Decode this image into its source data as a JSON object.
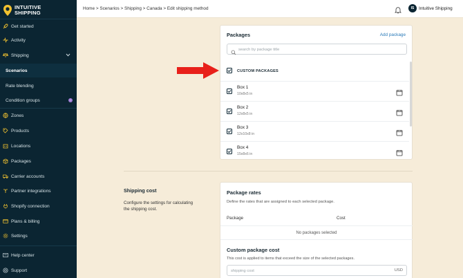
{
  "app": {
    "logo_line1": "INTUITIVE",
    "logo_line2": "SHIPPING"
  },
  "sidebar": {
    "items": [
      {
        "label": "Get started",
        "icon": "rocket-icon"
      },
      {
        "label": "Activity",
        "icon": "activity-icon"
      },
      {
        "label": "Shipping",
        "icon": "scale-icon"
      },
      {
        "label": "Scenarios"
      },
      {
        "label": "Rate blending"
      },
      {
        "label": "Condition groups",
        "badge": "i"
      },
      {
        "label": "Zones",
        "icon": "globe-icon"
      },
      {
        "label": "Products",
        "icon": "tag-icon"
      },
      {
        "label": "Locations",
        "icon": "building-icon"
      },
      {
        "label": "Packages",
        "icon": "boxes-icon"
      },
      {
        "label": "Carrier accounts",
        "icon": "truck-icon"
      },
      {
        "label": "Partner integrations",
        "icon": "link-icon"
      },
      {
        "label": "Shopify connection",
        "icon": "plug-icon"
      },
      {
        "label": "Plans & billing",
        "icon": "card-icon"
      },
      {
        "label": "Settings",
        "icon": "gear-icon"
      },
      {
        "label": "Help center",
        "icon": "help-icon"
      },
      {
        "label": "Support",
        "icon": "support-icon"
      }
    ]
  },
  "header": {
    "breadcrumb": "Home > Scenarios > Shipping > Canada > Edit shipping method",
    "user_initials": "IS",
    "user_name": "Intuitive Shipping"
  },
  "packages": {
    "title": "Packages",
    "add_label": "Add package",
    "search_placeholder": "search by package title",
    "group_label": "CUSTOM PACKAGES",
    "items": [
      {
        "name": "Box 1",
        "dims": "10x8x5 in"
      },
      {
        "name": "Box 2",
        "dims": "12x8x5 in"
      },
      {
        "name": "Box 3",
        "dims": "12x10x8 in"
      },
      {
        "name": "Box 4",
        "dims": "15x8x6 in"
      }
    ]
  },
  "shipping_cost": {
    "title": "Shipping cost",
    "description": "Configure the settings for calculating the shipping cost."
  },
  "package_rates": {
    "title": "Package rates",
    "description": "Define the rates that are assigned to each selected package.",
    "col_package": "Package",
    "col_cost": "Cost",
    "empty_text": "No packages selected"
  },
  "custom_cost": {
    "title": "Custom package cost",
    "description": "This cost is applied to items that exceed the size of the selected packages.",
    "placeholder": "shipping cost",
    "currency": "USD"
  },
  "colors": {
    "sidebar_bg": "#0b2532",
    "page_bg": "#f6ecd9",
    "link": "#2a7ab8",
    "annotation_arrow": "#e8201a"
  }
}
